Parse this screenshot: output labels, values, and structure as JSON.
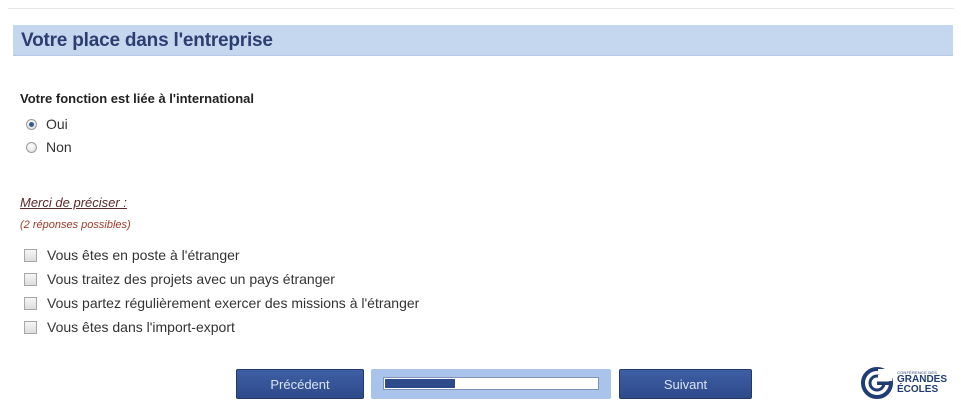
{
  "section": {
    "title": "Votre place dans l'entreprise"
  },
  "question": {
    "label": "Votre fonction est liée à l'international",
    "options": [
      {
        "label": "Oui",
        "selected": true
      },
      {
        "label": "Non",
        "selected": false
      }
    ]
  },
  "details": {
    "prompt": "Merci de préciser :",
    "hint": "(2 réponses possibles)",
    "options": [
      {
        "label": "Vous êtes en poste à l'étranger",
        "checked": false
      },
      {
        "label": "Vous traitez des projets avec un pays étranger",
        "checked": false
      },
      {
        "label": "Vous partez régulièrement exercer des missions à l'étranger",
        "checked": false
      },
      {
        "label": "Vous êtes dans l'import-export",
        "checked": false
      }
    ]
  },
  "navigation": {
    "previous_label": "Précédent",
    "next_label": "Suivant",
    "progress_fraction": 0.33
  },
  "logo": {
    "line1": "CONFÉRENCE DES",
    "line2": "GRANDES",
    "line3": "ÉCOLES"
  },
  "colors": {
    "header_bg": "#c5d7ef",
    "title": "#2c3e70",
    "button": "#2d4a8a",
    "hint": "#a03a2a"
  }
}
